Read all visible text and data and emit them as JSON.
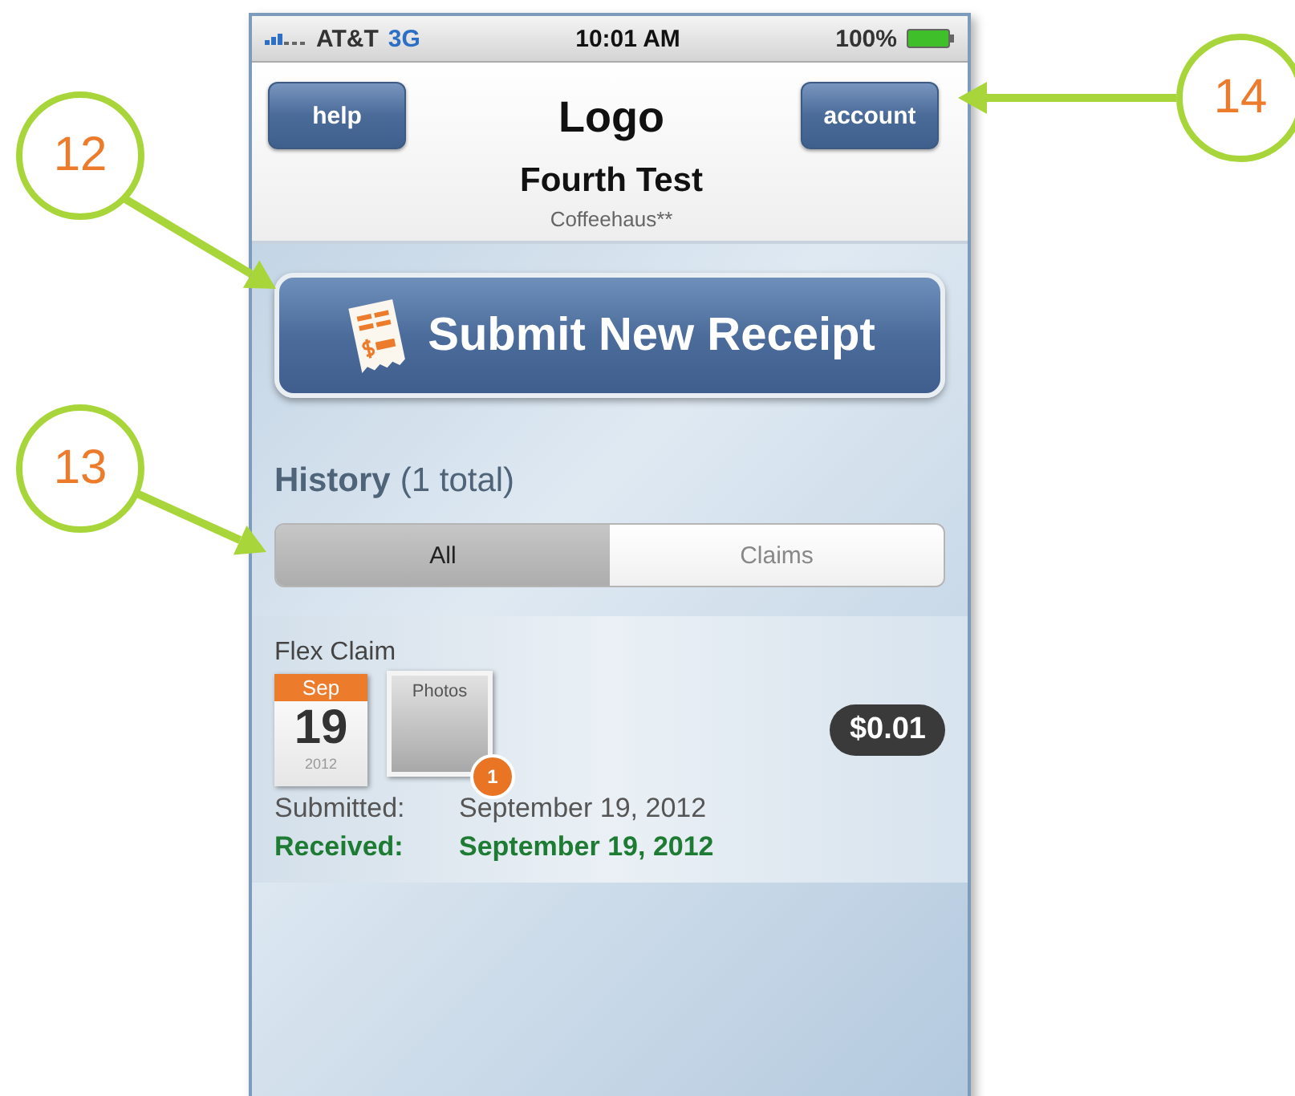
{
  "status_bar": {
    "carrier": "AT&T",
    "network": "3G",
    "time": "10:01 AM",
    "battery": "100%"
  },
  "header": {
    "left_button": "help",
    "logo": "Logo",
    "right_button": "account",
    "title": "Fourth Test",
    "subtitle": "Coffeehaus**"
  },
  "submit_button": "Submit New Receipt",
  "history": {
    "title": "History",
    "count": "(1 total)"
  },
  "tabs": [
    {
      "label": "All",
      "selected": true
    },
    {
      "label": "Claims",
      "selected": false
    }
  ],
  "claims": [
    {
      "type": "Flex Claim",
      "month": "Sep",
      "day": "19",
      "year": "2012",
      "photos_label": "Photos",
      "photo_count": "1",
      "amount": "$0.01",
      "dates": [
        {
          "label": "Submitted:",
          "value": "September 19, 2012",
          "received": false
        },
        {
          "label": "Received:",
          "value": "September 19, 2012",
          "received": true
        }
      ]
    }
  ],
  "callouts": [
    {
      "number": "12"
    },
    {
      "number": "13"
    },
    {
      "number": "14"
    }
  ]
}
